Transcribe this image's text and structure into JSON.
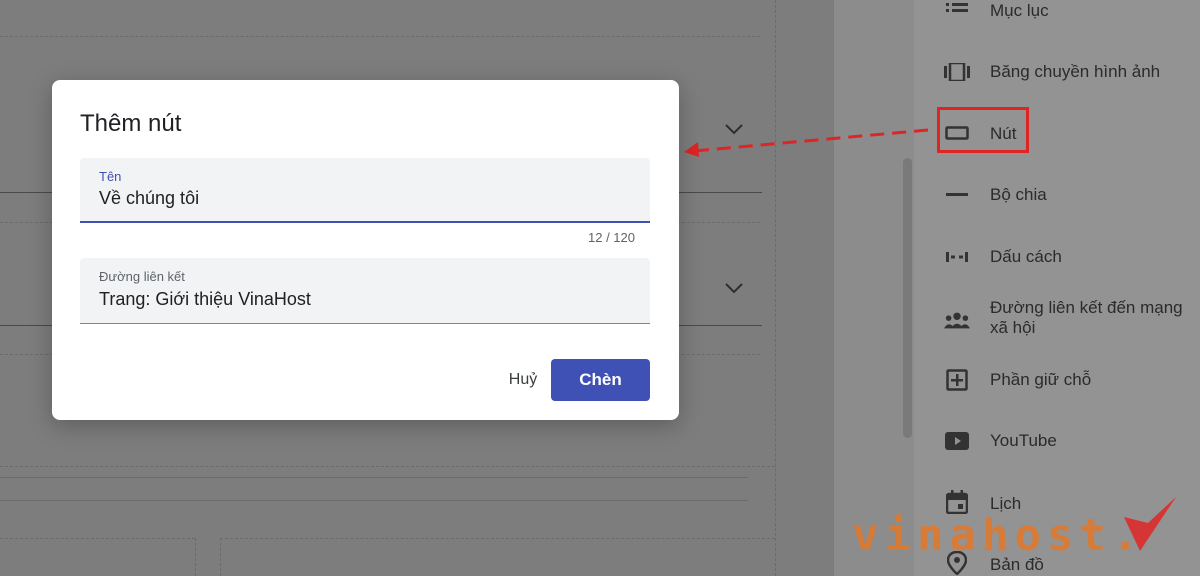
{
  "dialog": {
    "title": "Thêm nút",
    "name_field": {
      "label": "Tên",
      "value": "Về chúng tôi",
      "counter": "12 / 120"
    },
    "link_field": {
      "label": "Đường liên kết",
      "value": "Trang: Giới thiệu VinaHost"
    },
    "cancel_label": "Huỷ",
    "insert_label": "Chèn",
    "accent_color": "#3f51b5"
  },
  "insert_panel": {
    "items": [
      {
        "label": "Mục lục",
        "icon": "list-icon"
      },
      {
        "label": "Băng chuyền hình ảnh",
        "icon": "carousel-icon"
      },
      {
        "label": "Nút",
        "icon": "button-icon",
        "highlighted": true
      },
      {
        "label": "Bộ chia",
        "icon": "divider-icon"
      },
      {
        "label": "Dấu cách",
        "icon": "spacer-icon"
      },
      {
        "label": "Đường liên kết đến mạng xã hội",
        "icon": "people-icon"
      },
      {
        "label": "Phần giữ chỗ",
        "icon": "placeholder-icon"
      },
      {
        "label": "YouTube",
        "icon": "youtube-icon"
      },
      {
        "label": "Lịch",
        "icon": "calendar-icon"
      },
      {
        "label": "Bản đồ",
        "icon": "map-pin-icon"
      }
    ]
  },
  "annotation": {
    "highlight_color": "#e02424"
  },
  "watermark": {
    "text": "vinahost.",
    "color": "#e4772a"
  }
}
